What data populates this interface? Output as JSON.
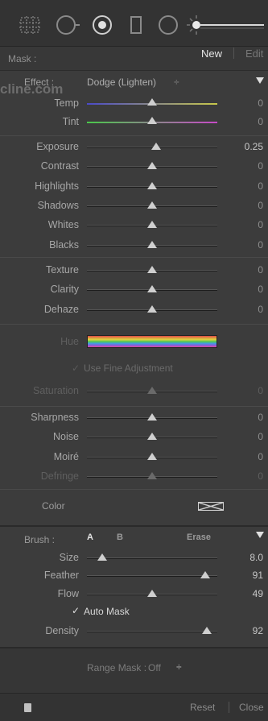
{
  "toolbar": {
    "tools": [
      "crop-grid-icon",
      "spot-removal-icon",
      "red-eye-icon",
      "graduated-filter-icon",
      "radial-filter-icon",
      "brush-icon"
    ]
  },
  "mask": {
    "label": "Mask :",
    "new_label": "New",
    "edit_label": "Edit"
  },
  "effect": {
    "label": "Effect :",
    "value": "Dodge (Lighten)",
    "arrow": "÷",
    "watermark": "cline.com"
  },
  "sliders_group1": [
    {
      "label": "Temp",
      "value": "0",
      "pos": 0.5,
      "kind": "temp"
    },
    {
      "label": "Tint",
      "value": "0",
      "pos": 0.5,
      "kind": "tint"
    }
  ],
  "sliders_group2": [
    {
      "label": "Exposure",
      "value": "0.25",
      "pos": 0.53
    },
    {
      "label": "Contrast",
      "value": "0",
      "pos": 0.5
    },
    {
      "label": "Highlights",
      "value": "0",
      "pos": 0.5
    },
    {
      "label": "Shadows",
      "value": "0",
      "pos": 0.5
    },
    {
      "label": "Whites",
      "value": "0",
      "pos": 0.5
    },
    {
      "label": "Blacks",
      "value": "0",
      "pos": 0.5
    }
  ],
  "sliders_group3": [
    {
      "label": "Texture",
      "value": "0",
      "pos": 0.5
    },
    {
      "label": "Clarity",
      "value": "0",
      "pos": 0.5
    },
    {
      "label": "Dehaze",
      "value": "0",
      "pos": 0.5
    }
  ],
  "hue": {
    "label": "Hue",
    "fine_label": "Use Fine Adjustment",
    "check": "✓"
  },
  "saturation": {
    "label": "Saturation",
    "value": "0",
    "pos": 0.5
  },
  "sliders_group4": [
    {
      "label": "Sharpness",
      "value": "0",
      "pos": 0.5
    },
    {
      "label": "Noise",
      "value": "0",
      "pos": 0.5
    },
    {
      "label": "Moiré",
      "value": "0",
      "pos": 0.5
    },
    {
      "label": "Defringe",
      "value": "0",
      "pos": 0.5,
      "dim": true
    }
  ],
  "color": {
    "label": "Color"
  },
  "brush": {
    "label": "Brush :",
    "a": "A",
    "b": "B",
    "erase": "Erase",
    "sliders": [
      {
        "label": "Size",
        "value": "8.0",
        "pos": 0.12
      },
      {
        "label": "Feather",
        "value": "91",
        "pos": 0.91
      },
      {
        "label": "Flow",
        "value": "49",
        "pos": 0.5
      }
    ],
    "auto_mask": "Auto Mask",
    "check": "✓",
    "density": {
      "label": "Density",
      "value": "92",
      "pos": 0.92
    }
  },
  "range_mask": {
    "label": "Range Mask :",
    "value": "Off",
    "arrow": "÷"
  },
  "footer": {
    "reset": "Reset",
    "close": "Close"
  }
}
